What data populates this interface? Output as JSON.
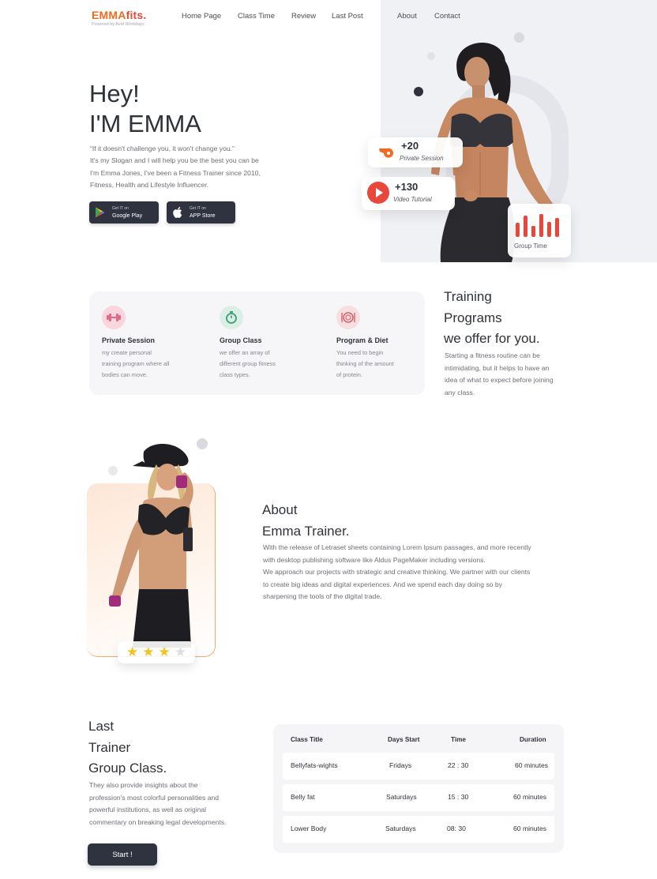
{
  "brand": {
    "name_a": "EMMA",
    "name_b": "fits.",
    "tagline": "Powered by Avid Workdays"
  },
  "nav": {
    "items": [
      "Home Page",
      "Class Time",
      "Review",
      "Last Post",
      "About",
      "Contact"
    ]
  },
  "hero": {
    "greeting": "Hey!",
    "name": "I'M EMMA",
    "quote": "“If it doesn't challenge you, it won't change you.”",
    "line1": "It's my Slogan and I will help you be the best you can be",
    "line2": "I'm Emma Jones, I've been a Fitness Trainer since 2010,",
    "line3": "Fitness, Health and Lifestyle Influencer.",
    "google": {
      "small": "Get IT on",
      "big": "Google Play"
    },
    "apple": {
      "small": "Get IT on",
      "big": "APP Store"
    },
    "stats": [
      {
        "value": "+20",
        "label": "Private Session",
        "icon": "whistle-icon"
      },
      {
        "value": "+130",
        "label": "Video Tutorial",
        "icon": "play-icon"
      }
    ],
    "group_time": {
      "label": "Group Time",
      "bars": [
        0.55,
        0.85,
        0.45,
        0.9,
        0.6,
        0.75
      ]
    }
  },
  "programs": {
    "title1": "Training",
    "title2": "Programs",
    "title3": "we offer for you.",
    "desc1": "Starting a fitness routine can be",
    "desc2": "intimidating, but it helps to have an",
    "desc3": "idea of what to expect before joining",
    "desc4": "any class.",
    "features": [
      {
        "title": "Private Session",
        "l1": "my create  personal",
        "l2": "training program where all",
        "l3": "bodies can move.",
        "icon": "dumbbell-icon"
      },
      {
        "title": "Group Class",
        "l1": "we offer an array of",
        "l2": "different group fitness",
        "l3": "class types.",
        "icon": "stopwatch-icon"
      },
      {
        "title": "Program & Diet",
        "l1": "You need to begin",
        "l2": "thinking of  the amount",
        "l3": "of protein.",
        "icon": "plate-icon"
      }
    ]
  },
  "about": {
    "title1": "About",
    "title2": "Emma Trainer.",
    "p1": "With the release of Letraset sheets containing Lorem Ipsum passages, and more recently",
    "p2": "with desktop publishing software like Aldus PageMaker including versions.",
    "p3": "We approach our projects with strategic and creative thinking. We partner with our clients",
    "p4": "to create big ideas and digital experiences. And we spend each day doing so by",
    "p5": "sharpening the tools of the digital trade.",
    "rating": 3,
    "rating_max": 4
  },
  "group_class": {
    "title1": "Last",
    "title2": "Trainer",
    "title3": "Group Class.",
    "d1": "They also provide insights about the",
    "d2": "profession's most colorful personalities and",
    "d3": "powerful institutions, as well as original",
    "d4": "commentary on breaking legal developments.",
    "start_label": "Start !",
    "headers": [
      "Class Title",
      "Days Start",
      "Time",
      "Duration"
    ],
    "rows": [
      [
        "Bellyfats-wights",
        "Fridays",
        "22 : 30",
        "60 minutes"
      ],
      [
        "Belly fat",
        "Saturdays",
        "15 : 30",
        "60 minutes"
      ],
      [
        "Lower Body",
        "Saturdays",
        "08: 30",
        "60 minutes"
      ]
    ]
  },
  "colors": {
    "accent": "#e8473b",
    "orange": "#f06b22",
    "dark": "#2f3340",
    "star": "#f6c21c"
  }
}
